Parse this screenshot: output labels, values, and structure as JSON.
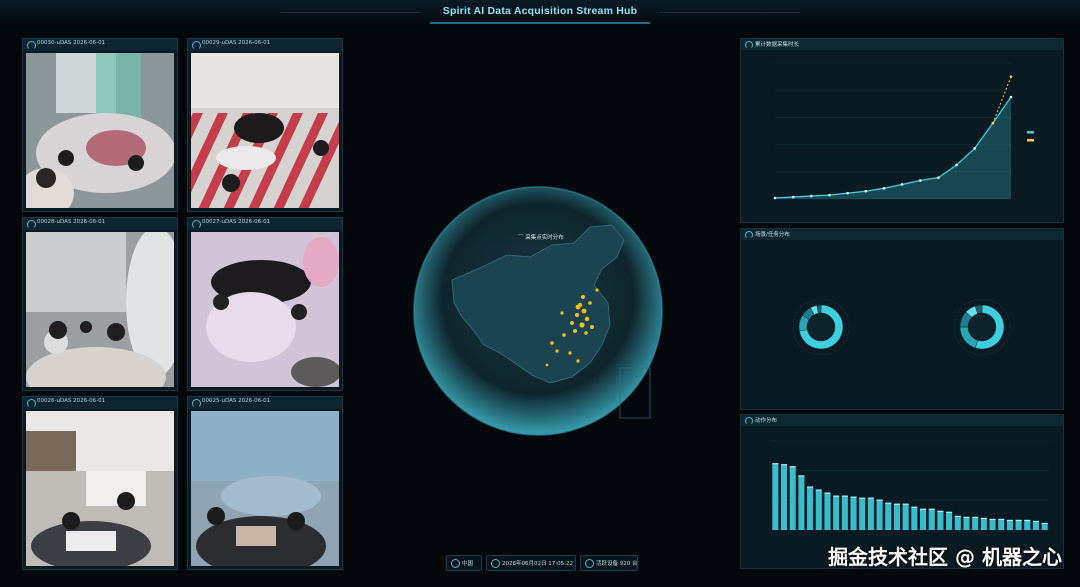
{
  "header": {
    "title": "Spirit AI Data Acquisition Stream Hub"
  },
  "cameras": [
    {
      "label": "00030-uDAS 2026-06-01"
    },
    {
      "label": "00029-uDAS 2026-06-01"
    },
    {
      "label": "00028-uDAS 2026-06-01"
    },
    {
      "label": "00027-uDAS 2026-06-01"
    },
    {
      "label": "00026-uDAS 2026-06-01"
    },
    {
      "label": "00025-uDAS 2026-06-01"
    }
  ],
  "map": {
    "title": "采集点实时分布"
  },
  "panels": {
    "trend": "累计数据采集时长",
    "distribution": "场景/任务分布",
    "actions": "动作分布"
  },
  "footer": {
    "region": "中国",
    "datetime": "2026年06月02日 17:05:22",
    "devices": "活跃设备 920 台"
  },
  "watermark": "掘金技术社区 @ 机器之心",
  "colors": {
    "accent": "#3ecfdf",
    "forecast": "#f5c842",
    "map_points": "#f0c020"
  },
  "chart_data": [
    {
      "type": "line",
      "title": "累计数据采集时长",
      "x_count": 14,
      "series": [
        {
          "values": [
            1,
            2,
            3,
            4,
            6,
            8,
            11,
            15,
            19,
            22,
            35,
            52,
            78,
            105
          ]
        },
        {
          "values": [
            null,
            null,
            null,
            null,
            null,
            null,
            null,
            null,
            null,
            null,
            null,
            null,
            78,
            126
          ]
        }
      ],
      "ylim": [
        0,
        140
      ]
    },
    {
      "type": "pie",
      "title": "场景/任务分布",
      "charts": [
        {
          "slices": [
            0.72,
            0.12,
            0.08,
            0.05,
            0.03
          ]
        },
        {
          "slices": [
            0.55,
            0.2,
            0.12,
            0.08,
            0.05
          ]
        }
      ]
    },
    {
      "type": "bar",
      "title": "动作分布",
      "values": [
        66,
        65,
        63,
        54,
        43,
        40,
        37,
        34,
        34,
        33,
        32,
        32,
        30,
        27,
        26,
        26,
        23,
        21,
        21,
        19,
        18,
        14,
        13,
        13,
        12,
        11,
        11,
        10,
        10,
        10,
        9,
        7
      ],
      "ylim": [
        0,
        88
      ]
    }
  ]
}
